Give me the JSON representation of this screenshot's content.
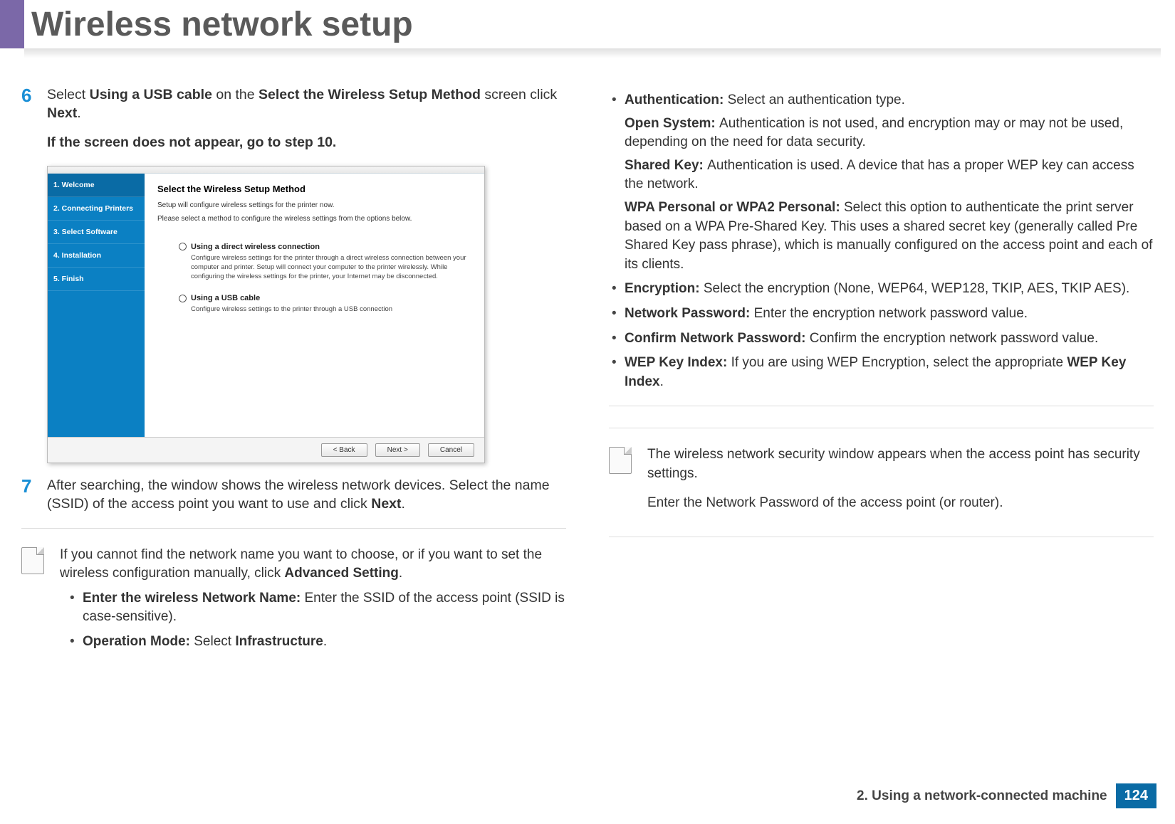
{
  "header": {
    "title": "Wireless network setup"
  },
  "left": {
    "step6": {
      "num": "6",
      "line1_a": "Select ",
      "line1_b": "Using a USB cable",
      "line1_c": " on the ",
      "line1_d": "Select the Wireless Setup Method",
      "line1_e": " screen click ",
      "line1_f": "Next",
      "line1_g": ".",
      "line2": " If the screen does not appear, go to step 10."
    },
    "screenshot": {
      "sidebar": [
        "1. Welcome",
        "2. Connecting Printers",
        "3. Select Software",
        "4. Installation",
        "5. Finish"
      ],
      "heading": "Select the Wireless Setup Method",
      "sub1": "Setup will configure wireless settings for the printer now.",
      "sub2": "Please select a method to configure the wireless settings from the options below.",
      "opt1_title": "Using a direct wireless connection",
      "opt1_desc": "Configure wireless settings for the printer through a direct wireless connection between your computer and printer. Setup will connect your computer to the printer wirelessly. While configuring the wireless settings for the printer, your Internet may be disconnected.",
      "opt2_title": "Using a USB cable",
      "opt2_desc": "Configure wireless settings to the printer through a USB connection",
      "btn_back": "< Back",
      "btn_next": "Next >",
      "btn_cancel": "Cancel"
    },
    "step7": {
      "num": "7",
      "text_a": "After searching, the window shows the wireless network devices. Select the name (SSID) of the access point you want to use and click ",
      "text_b": "Next",
      "text_c": "."
    },
    "note1": {
      "line1_a": "If you cannot find the network name you want to choose, or if you want to set the wireless configuration manually, click ",
      "line1_b": "Advanced Setting",
      "line1_c": ".",
      "b1_a": "Enter the wireless Network Name: ",
      "b1_b": "Enter the SSID of the access point (SSID is case-sensitive).",
      "b2_a": "Operation Mode: ",
      "b2_b": "Select ",
      "b2_c": "Infrastructure",
      "b2_d": "."
    }
  },
  "right": {
    "bullets": {
      "auth_label": "Authentication: ",
      "auth_text": "Select an authentication type.",
      "open_label": "Open System: ",
      "open_text": "Authentication is not used, and encryption may or may not be used, depending on the need for data security.",
      "shared_label": "Shared Key: ",
      "shared_text": "Authentication is used. A device that has a proper WEP key can access the network.",
      "wpa_label": "WPA Personal or WPA2 Personal: ",
      "wpa_text": "Select this option to authenticate the print server based on a WPA Pre-Shared Key. This uses a shared secret key (generally called Pre Shared Key pass phrase), which is manually configured on the access point and each of its clients.",
      "enc_label": "Encryption: ",
      "enc_text": "Select the encryption (None, WEP64, WEP128, TKIP, AES, TKIP AES).",
      "np_label": "Network Password: ",
      "np_text": "Enter the encryption network password value.",
      "cnp_label": "Confirm Network Password: ",
      "cnp_text": "Confirm the encryption network password value.",
      "wep_label": "WEP Key Index: ",
      "wep_text_a": "If you are using WEP Encryption, select the appropriate ",
      "wep_text_b": "WEP Key Index",
      "wep_text_c": "."
    },
    "note2": {
      "line1": "The wireless network security window appears when the access point has security settings.",
      "line2": "Enter the Network Password of the access point (or router)."
    }
  },
  "footer": {
    "chapter": "2.  Using a network-connected machine",
    "page": "124"
  }
}
